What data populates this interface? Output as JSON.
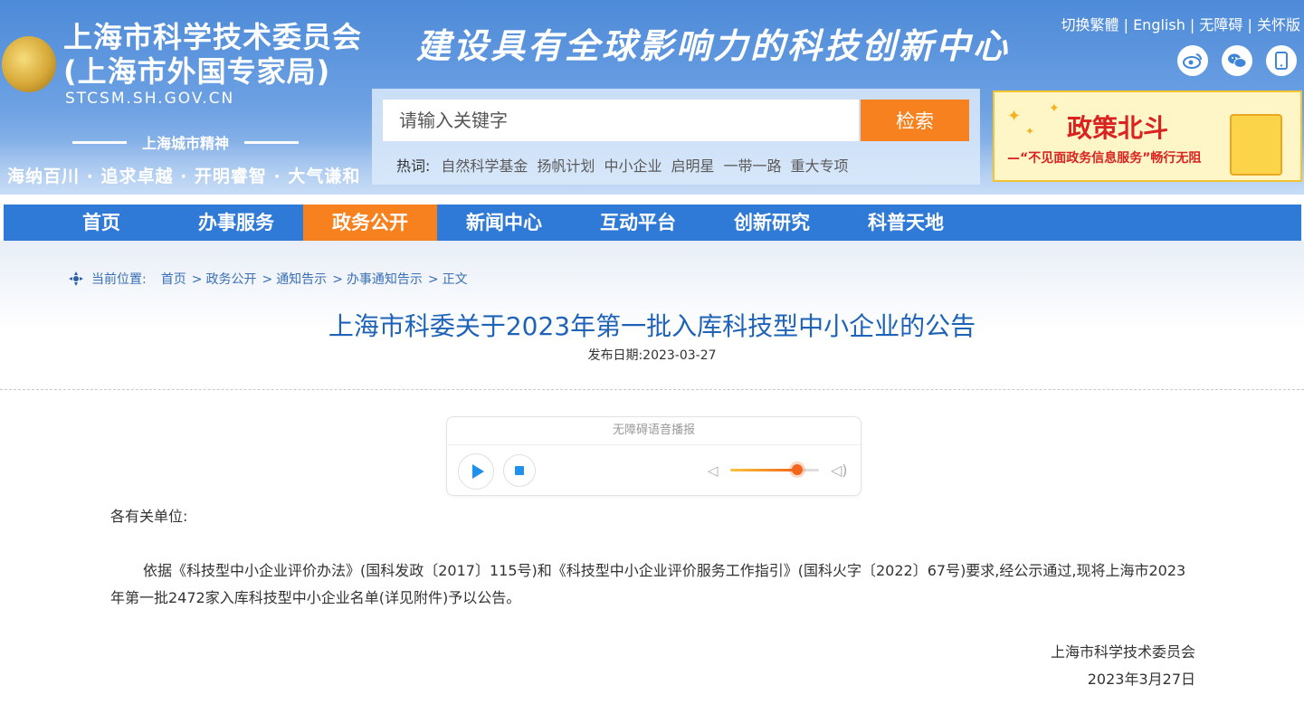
{
  "header": {
    "emblem_text": "",
    "site_title_line1": "上海市科学技术委员会",
    "site_title_line2": "(上海市外国专家局)",
    "site_domain": "STCSM.SH.GOV.CN",
    "spirit_title": "上海城市精神",
    "spirit_text": "海纳百川 · 追求卓越 · 开明睿智 · 大气谦和",
    "slogan": "建设具有全球影响力的科技创新中心",
    "top_links": [
      "切换繁體",
      "English",
      "无障碍",
      "关怀版"
    ],
    "social_icons": [
      "weibo-icon",
      "wechat-icon",
      "mobile-icon"
    ]
  },
  "search": {
    "placeholder": "请输入关键字",
    "button_label": "检索",
    "hotwords_label": "热词:",
    "hotwords": [
      "自然科学基金",
      "扬帆计划",
      "中小企业",
      "启明星",
      "一带一路",
      "重大专项"
    ]
  },
  "banner": {
    "title": "政策北斗",
    "subtitle": "—“不见面政务信息服务”畅行无阻"
  },
  "nav": {
    "items": [
      "首页",
      "办事服务",
      "政务公开",
      "新闻中心",
      "互动平台",
      "创新研究",
      "科普天地"
    ],
    "active_index": 2,
    "active_color": "#f7811e",
    "bar_color": "#2f7ad6"
  },
  "breadcrumb": {
    "label": "当前位置:",
    "items": [
      "首页",
      "政务公开",
      "通知告示",
      "办事通知告示",
      "正文"
    ]
  },
  "article": {
    "title": "上海市科委关于2023年第一批入库科技型中小企业的公告",
    "date_label": "发布日期:",
    "date": "2023-03-27",
    "salutation": "各有关单位:",
    "paragraph": "依据《科技型中小企业评价办法》(国科发政〔2017〕115号)和《科技型中小企业评价服务工作指引》(国科火字〔2022〕67号)要求,经公示通过,现将上海市2023年第一批2472家入库科技型中小企业名单(详见附件)予以公告。",
    "sign_org": "上海市科学技术委员会",
    "sign_date": "2023年3月27日"
  },
  "player": {
    "title": "无障碍语音播报",
    "volume_level": 0.75
  }
}
